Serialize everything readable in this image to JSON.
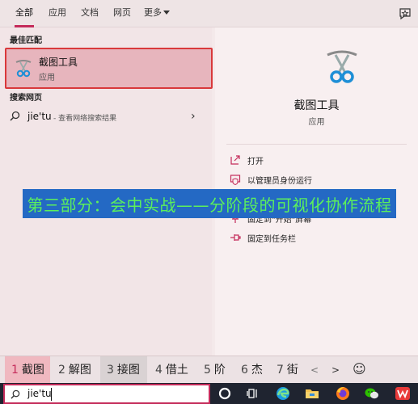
{
  "tabs": {
    "all": "全部",
    "apps": "应用",
    "documents": "文档",
    "web": "网页",
    "more": "更多"
  },
  "best_match": {
    "heading": "最佳匹配",
    "title": "截图工具",
    "subtitle": "应用"
  },
  "web_search": {
    "heading": "搜索网页",
    "query": "jie'tu",
    "hint": "- 查看网络搜索结果"
  },
  "detail": {
    "title": "截图工具",
    "subtitle": "应用",
    "actions": {
      "open": "打开",
      "run_as_admin": "以管理员身份运行",
      "pin_start": "固定到\"开始\"屏幕",
      "pin_taskbar": "固定到任务栏"
    }
  },
  "banner": {
    "text": "第三部分：会中实战——分阶段的可视化协作流程"
  },
  "ime": {
    "candidates": [
      {
        "num": "1",
        "text": "截图"
      },
      {
        "num": "2",
        "text": "解图"
      },
      {
        "num": "3",
        "text": "接图"
      },
      {
        "num": "4",
        "text": "借土"
      },
      {
        "num": "5",
        "text": "阶"
      },
      {
        "num": "6",
        "text": "杰"
      },
      {
        "num": "7",
        "text": "街"
      }
    ],
    "prev": "<",
    "next": ">",
    "emoji": "☺"
  },
  "taskbar": {
    "search_text": "jie'tu"
  },
  "colors": {
    "accent": "#c42b5a",
    "highlight_border": "#d9383b",
    "banner_bg": "#2469c4",
    "banner_text": "#5cf05c",
    "taskbar_bg": "#1f2430"
  },
  "icons": {
    "app": "scissors-icon",
    "search": "search-icon",
    "chevron": "chevron-right-icon"
  }
}
